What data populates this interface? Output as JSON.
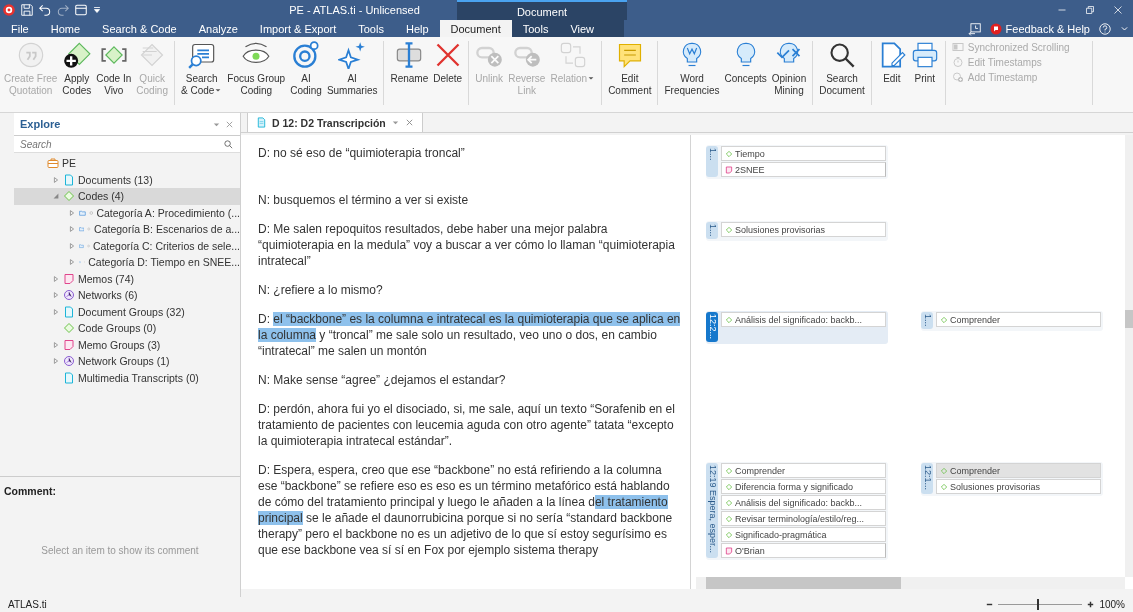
{
  "title_bar": {
    "title": "PE - ATLAS.ti - Unlicensed",
    "context_group": "Document"
  },
  "menu_tabs": [
    {
      "label": "File",
      "selected": false
    },
    {
      "label": "Home",
      "selected": false
    },
    {
      "label": "Search & Code",
      "selected": false
    },
    {
      "label": "Analyze",
      "selected": false
    },
    {
      "label": "Import & Export",
      "selected": false
    },
    {
      "label": "Tools",
      "selected": false
    },
    {
      "label": "Help",
      "selected": false
    },
    {
      "label": "Document",
      "selected": true
    },
    {
      "label": "Tools",
      "selected": false
    },
    {
      "label": "View",
      "selected": false
    }
  ],
  "feedback": "Feedback & Help",
  "ribbon": {
    "groups": [
      {
        "items": [
          {
            "label": "Create Free\nQuotation",
            "disabled": true
          },
          {
            "label": "Apply\nCodes",
            "disabled": false
          },
          {
            "label": "Code In\nVivo",
            "disabled": false
          },
          {
            "label": "Quick\nCoding",
            "disabled": true
          }
        ]
      },
      {
        "items": [
          {
            "label": "Search\n& Code",
            "disabled": false,
            "dropdown": true
          },
          {
            "label": "Focus Group\nCoding",
            "disabled": false
          },
          {
            "label": "AI\nCoding",
            "disabled": false
          },
          {
            "label": "AI\nSummaries",
            "disabled": false
          }
        ]
      },
      {
        "items": [
          {
            "label": "Rename",
            "disabled": false
          },
          {
            "label": "Delete",
            "disabled": false
          }
        ]
      },
      {
        "items": [
          {
            "label": "Unlink",
            "disabled": true
          },
          {
            "label": "Reverse\nLink",
            "disabled": true
          },
          {
            "label": "Relation",
            "disabled": true,
            "dropdown": true
          }
        ]
      },
      {
        "items": [
          {
            "label": "Edit\nComment",
            "disabled": false
          }
        ]
      },
      {
        "items": [
          {
            "label": "Word\nFrequencies",
            "disabled": false
          },
          {
            "label": "Concepts",
            "disabled": false
          },
          {
            "label": "Opinion\nMining",
            "disabled": false
          }
        ]
      },
      {
        "items": [
          {
            "label": "Search\nDocument",
            "disabled": false
          }
        ]
      },
      {
        "items": [
          {
            "label": "Edit",
            "disabled": false
          },
          {
            "label": "Print",
            "disabled": false
          }
        ]
      }
    ],
    "options": [
      {
        "label": "Synchronized Scrolling",
        "disabled": true
      },
      {
        "label": "Edit Timestamps",
        "disabled": true
      },
      {
        "label": "Add Timestamp",
        "disabled": true
      }
    ]
  },
  "explore": {
    "title": "Explore",
    "search_placeholder": "Search",
    "tree": [
      {
        "label": "PE",
        "kind": "project",
        "expandable": false,
        "selected": false,
        "children": [
          {
            "label": "Documents (13)",
            "kind": "document",
            "expandable": true,
            "expanded": false,
            "selected": false
          },
          {
            "label": "Codes (4)",
            "kind": "code",
            "expandable": true,
            "expanded": true,
            "selected": true,
            "children": [
              {
                "label": "Categoría A: Procedimiento (...",
                "kind": "category",
                "expandable": true,
                "expanded": false,
                "selected": false
              },
              {
                "label": "Categoría B: Escenarios de a...",
                "kind": "category",
                "expandable": true,
                "expanded": false,
                "selected": false
              },
              {
                "label": "Categoría C: Criterios de sele...",
                "kind": "category",
                "expandable": true,
                "expanded": false,
                "selected": false
              },
              {
                "label": "Categoría D: Tiempo en SNEE...",
                "kind": "category",
                "expandable": true,
                "expanded": false,
                "selected": false
              }
            ]
          },
          {
            "label": "Memos (74)",
            "kind": "memo",
            "expandable": true,
            "expanded": false,
            "selected": false
          },
          {
            "label": "Networks (6)",
            "kind": "network",
            "expandable": true,
            "expanded": false,
            "selected": false
          },
          {
            "label": "Document Groups (32)",
            "kind": "document",
            "expandable": true,
            "expanded": false,
            "selected": false
          },
          {
            "label": "Code Groups (0)",
            "kind": "code",
            "expandable": false,
            "selected": false
          },
          {
            "label": "Memo Groups (3)",
            "kind": "memo",
            "expandable": true,
            "expanded": false,
            "selected": false
          },
          {
            "label": "Network Groups (1)",
            "kind": "network",
            "expandable": true,
            "expanded": false,
            "selected": false
          },
          {
            "label": "Multimedia Transcripts (0)",
            "kind": "document",
            "expandable": false,
            "selected": false
          }
        ]
      }
    ]
  },
  "comment_pane": {
    "title": "Comment:",
    "empty_text": "Select an item to show its comment"
  },
  "document": {
    "tab": "D 12: D2 Transcripción",
    "paragraphs": [
      {
        "segments": [
          {
            "text": "D: no sé eso de “quimioterapia troncal”",
            "highlighted": false
          }
        ],
        "margin_1": [
          {
            "label": "1...",
            "selected": false,
            "entries": [
              {
                "kind": "code",
                "text": "Tiempo",
                "selected": false
              },
              {
                "kind": "memo",
                "text": "2SNEE",
                "selected": false
              }
            ]
          }
        ]
      },
      {
        "segments": [
          {
            "text": "N: busquemos el término a ver si existe",
            "highlighted": false
          }
        ]
      },
      {
        "segments": [
          {
            "text": "D: Me salen repoquitos resultados, debe haber una mejor palabra “quimioterapia en la medula” voy a buscar a ver cómo lo llaman “quimioterapia intratecal”",
            "highlighted": false
          }
        ],
        "margin_1": [
          {
            "label": "1...",
            "selected": false,
            "entries": [
              {
                "kind": "code",
                "text": "Solusiones provisorias",
                "selected": false
              }
            ]
          }
        ]
      },
      {
        "segments": [
          {
            "text": "N: ¿refiere a lo mismo?",
            "highlighted": false
          }
        ]
      },
      {
        "segments": [
          {
            "text": "D: ",
            "highlighted": false
          },
          {
            "text": "el “backbone” es la columna e intratecal es la quimioterapia que se aplica en la columna",
            "highlighted": true
          },
          {
            "text": " y “troncal” me sale solo un resultado, veo uno o dos, en cambio “intratecal” me salen un montón",
            "highlighted": false
          }
        ],
        "margin_1": [
          {
            "label": "12:2...",
            "selected": true,
            "entries": [
              {
                "kind": "code",
                "text": "Análisis del significado: backb...",
                "selected": false
              }
            ]
          }
        ],
        "margin_2": [
          {
            "label": "1...",
            "selected": false,
            "entries": [
              {
                "kind": "code",
                "text": "Comprender",
                "selected": false
              }
            ]
          }
        ]
      },
      {
        "segments": [
          {
            "text": "N: Make sense “agree” ¿dejamos el estandar?",
            "highlighted": false
          }
        ]
      },
      {
        "segments": [
          {
            "text": "D: perdón, ahora fui yo el disociado, si, me sale, aquí un texto “Sorafenib en el tratamiento de pacientes con leucemia aguda con otro agente” tatata “excepto la quimioterapia intratecal estándar”.",
            "highlighted": false
          }
        ]
      },
      {
        "segments": [
          {
            "text": "D: Espera, espera, creo que ese “backbone” no está refiriendo a la columna ese “backbone” se refiere eso es eso es un término metafórico está hablando de cómo del tratamiento principal y luego le añaden a la línea d",
            "highlighted": false
          },
          {
            "text": "el tratamiento principal",
            "highlighted": true
          },
          {
            "text": " se le añade el daunorrubicina porque si no sería “standard backbone therapy” pero el backbone no es un adjetivo de lo que sí estoy segurísimo es que ese backbone vea sí sí en Fox por ejemplo sistema therapy",
            "highlighted": false
          }
        ],
        "margin_1": [
          {
            "label": "12:19 Espera, esper...",
            "selected": false,
            "entries": [
              {
                "kind": "code",
                "text": "Comprender",
                "selected": false
              },
              {
                "kind": "code",
                "text": "Diferencia forma y significado",
                "selected": false
              },
              {
                "kind": "code",
                "text": "Análisis del significado: backb...",
                "selected": false
              },
              {
                "kind": "code",
                "text": "Revisar terminología/estilo/reg...",
                "selected": false
              },
              {
                "kind": "code",
                "text": "Significado-pragmática",
                "selected": false
              },
              {
                "kind": "memo",
                "text": "O'Brian",
                "selected": false
              }
            ]
          }
        ],
        "margin_2": [
          {
            "label": "12:1...",
            "selected": false,
            "entries": [
              {
                "kind": "code",
                "text": "Comprender",
                "selected": true
              },
              {
                "kind": "code",
                "text": "Solusiones provisorias",
                "selected": false
              }
            ]
          }
        ]
      }
    ]
  },
  "status_bar": {
    "app": "ATLAS.ti",
    "zoom": {
      "level": 0.46
    },
    "zoom_text": "100%"
  }
}
